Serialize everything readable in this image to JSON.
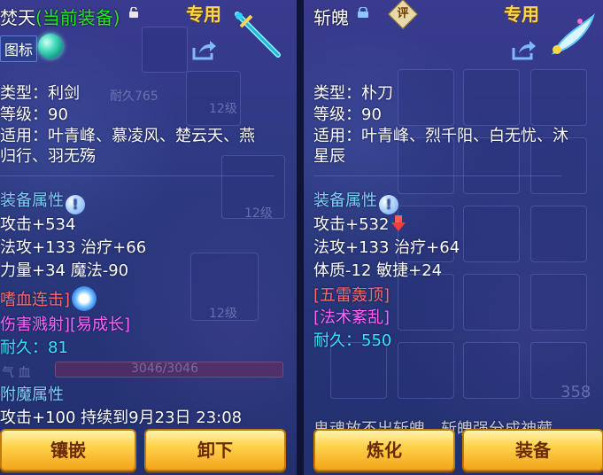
{
  "left": {
    "title_name": "焚天",
    "title_status": "(当前装备)",
    "tag": "专用",
    "icon_badge": "图标",
    "ghost": {
      "durability": "耐久765",
      "level_a": "12级",
      "level_b": "12级",
      "level_c": "12级",
      "hp_label": "气 血",
      "hp_value": "3046/3046"
    },
    "lines": {
      "type": "类型：利剑",
      "level": "等级：90",
      "usable_1": "适用：叶青峰、慕凌风、楚云天、燕",
      "usable_2": "归行、羽无殇",
      "attr_title": "装备属性",
      "attack": "攻击+534",
      "magic_heal": "法攻+133 治疗+66",
      "str_magic": "力量+34 魔法-90",
      "skill_1": "嗜血连击]",
      "skill_2": "伤害溅射][易成长]",
      "durability": "耐久：81",
      "enchant_title": "附魔属性",
      "enchant": "攻击+100 持续到9月23日 23:08"
    },
    "buttons": {
      "inlay": "镶嵌",
      "unequip": "卸下"
    }
  },
  "right": {
    "title_name": "斩魄",
    "badge": "评",
    "tag": "专用",
    "ghost": {
      "count": "358"
    },
    "lines": {
      "type": "类型：朴刀",
      "level": "等级：90",
      "usable_1": "适用：叶青峰、烈千阳、白无忧、沐",
      "usable_2": "星辰",
      "attr_title": "装备属性",
      "attack": "攻击+532",
      "magic_heal": "法攻+133 治疗+64",
      "con_agi": "体质-12 敏捷+24",
      "skill_1": "[五雷轰顶]",
      "skill_2": "[法术紊乱]",
      "durability": "耐久：550",
      "cut_text": "鬼魂放不出斩魄，斩魄强分成神藏"
    },
    "buttons": {
      "refine": "炼化",
      "equip": "装备"
    }
  },
  "colors": {
    "accent_gold": "#ffd64a",
    "green": "#2ee02e",
    "section_blue": "#7fd0ff",
    "skill_red": "#ff6b6b",
    "skill_pink": "#ff63ff",
    "durability_cyan": "#3fe0ff"
  }
}
